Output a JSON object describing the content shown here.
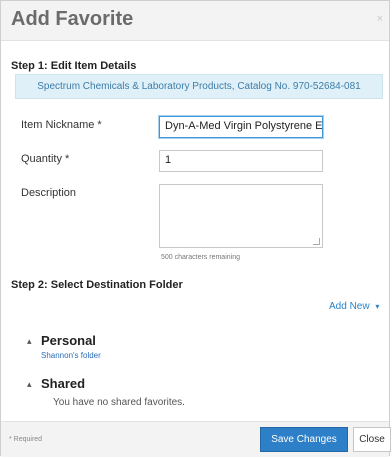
{
  "dialog": {
    "title": "Add Favorite",
    "close_icon": "close-icon"
  },
  "step1": {
    "heading": "Step 1: Edit Item Details",
    "product_banner": "Spectrum Chemicals & Laboratory Products, Catalog No. 970-52684-081",
    "nickname": {
      "label": "Item Nickname *",
      "value": "Dyn-A-Med Virgin Polystyrene E"
    },
    "quantity": {
      "label": "Quantity *",
      "value": "1"
    },
    "description": {
      "label": "Description",
      "value": "",
      "chars_remaining": "500 characters remaining"
    }
  },
  "step2": {
    "heading": "Step 2: Select Destination Folder",
    "add_new": "Add New",
    "add_new_icon": "caret-down-icon",
    "personal": {
      "toggle_icon": "collapse-caret-icon",
      "title": "Personal",
      "folder": "Shannon's folder"
    },
    "shared": {
      "toggle_icon": "collapse-caret-icon",
      "title": "Shared",
      "empty_text": "You have no shared favorites."
    }
  },
  "footer": {
    "required_note": "* Required",
    "save_label": "Save Changes",
    "close_label": "Close"
  }
}
